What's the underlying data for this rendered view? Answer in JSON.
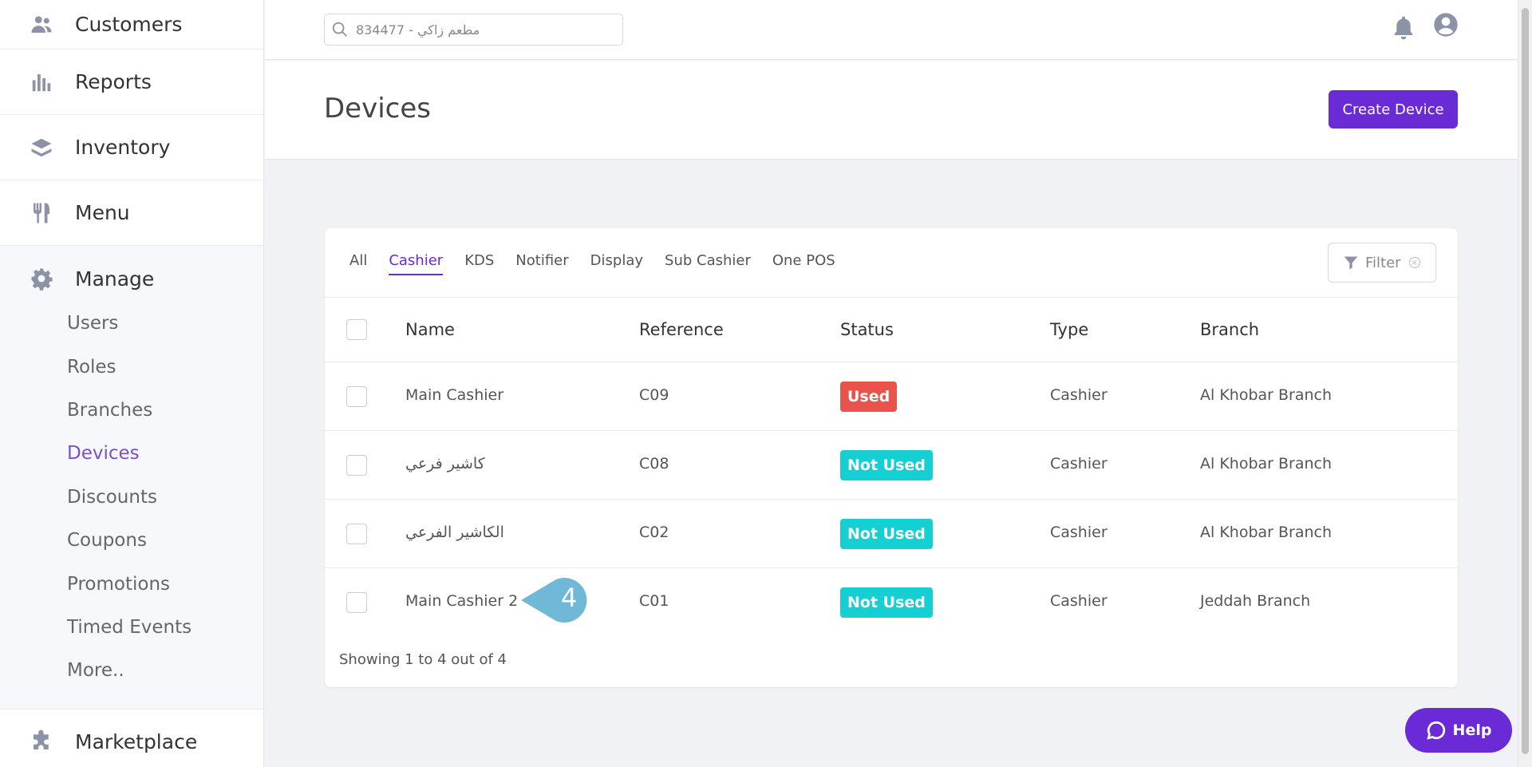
{
  "sidebar": {
    "items": [
      {
        "label": "Customers",
        "icon": "customers-icon"
      },
      {
        "label": "Reports",
        "icon": "bar-chart-icon"
      },
      {
        "label": "Inventory",
        "icon": "layers-icon"
      },
      {
        "label": "Menu",
        "icon": "utensils-icon"
      }
    ],
    "manage": {
      "label": "Manage",
      "icon": "gear-icon",
      "subitems": [
        "Users",
        "Roles",
        "Branches",
        "Devices",
        "Discounts",
        "Coupons",
        "Promotions",
        "Timed Events",
        "More.."
      ],
      "active": "Devices"
    },
    "marketplace": {
      "label": "Marketplace",
      "icon": "puzzle-icon"
    }
  },
  "topbar": {
    "search_placeholder": "مطعم زاكي - 834477"
  },
  "header": {
    "title": "Devices",
    "create_button": "Create Device"
  },
  "tabs": {
    "items": [
      "All",
      "Cashier",
      "KDS",
      "Notifier",
      "Display",
      "Sub Cashier",
      "One POS"
    ],
    "active": "Cashier"
  },
  "filter": {
    "label": "Filter"
  },
  "table": {
    "columns": [
      "Name",
      "Reference",
      "Status",
      "Type",
      "Branch"
    ],
    "rows": [
      {
        "name": "Main Cashier",
        "reference": "C09",
        "status": "Used",
        "type": "Cashier",
        "branch": "Al Khobar Branch"
      },
      {
        "name": "كاشير فرعي",
        "reference": "C08",
        "status": "Not Used",
        "type": "Cashier",
        "branch": "Al Khobar Branch"
      },
      {
        "name": "الكاشير الفرعي",
        "reference": "C02",
        "status": "Not Used",
        "type": "Cashier",
        "branch": "Al Khobar Branch"
      },
      {
        "name": "Main Cashier 2",
        "reference": "C01",
        "status": "Not Used",
        "type": "Cashier",
        "branch": "Jeddah Branch"
      }
    ],
    "footer": "Showing 1 to 4 out of 4"
  },
  "callout": {
    "number": "4"
  },
  "help": {
    "label": "Help"
  },
  "colors": {
    "accent": "#6a2bd6",
    "used": "#e9534c",
    "not_used": "#15cfd3"
  }
}
